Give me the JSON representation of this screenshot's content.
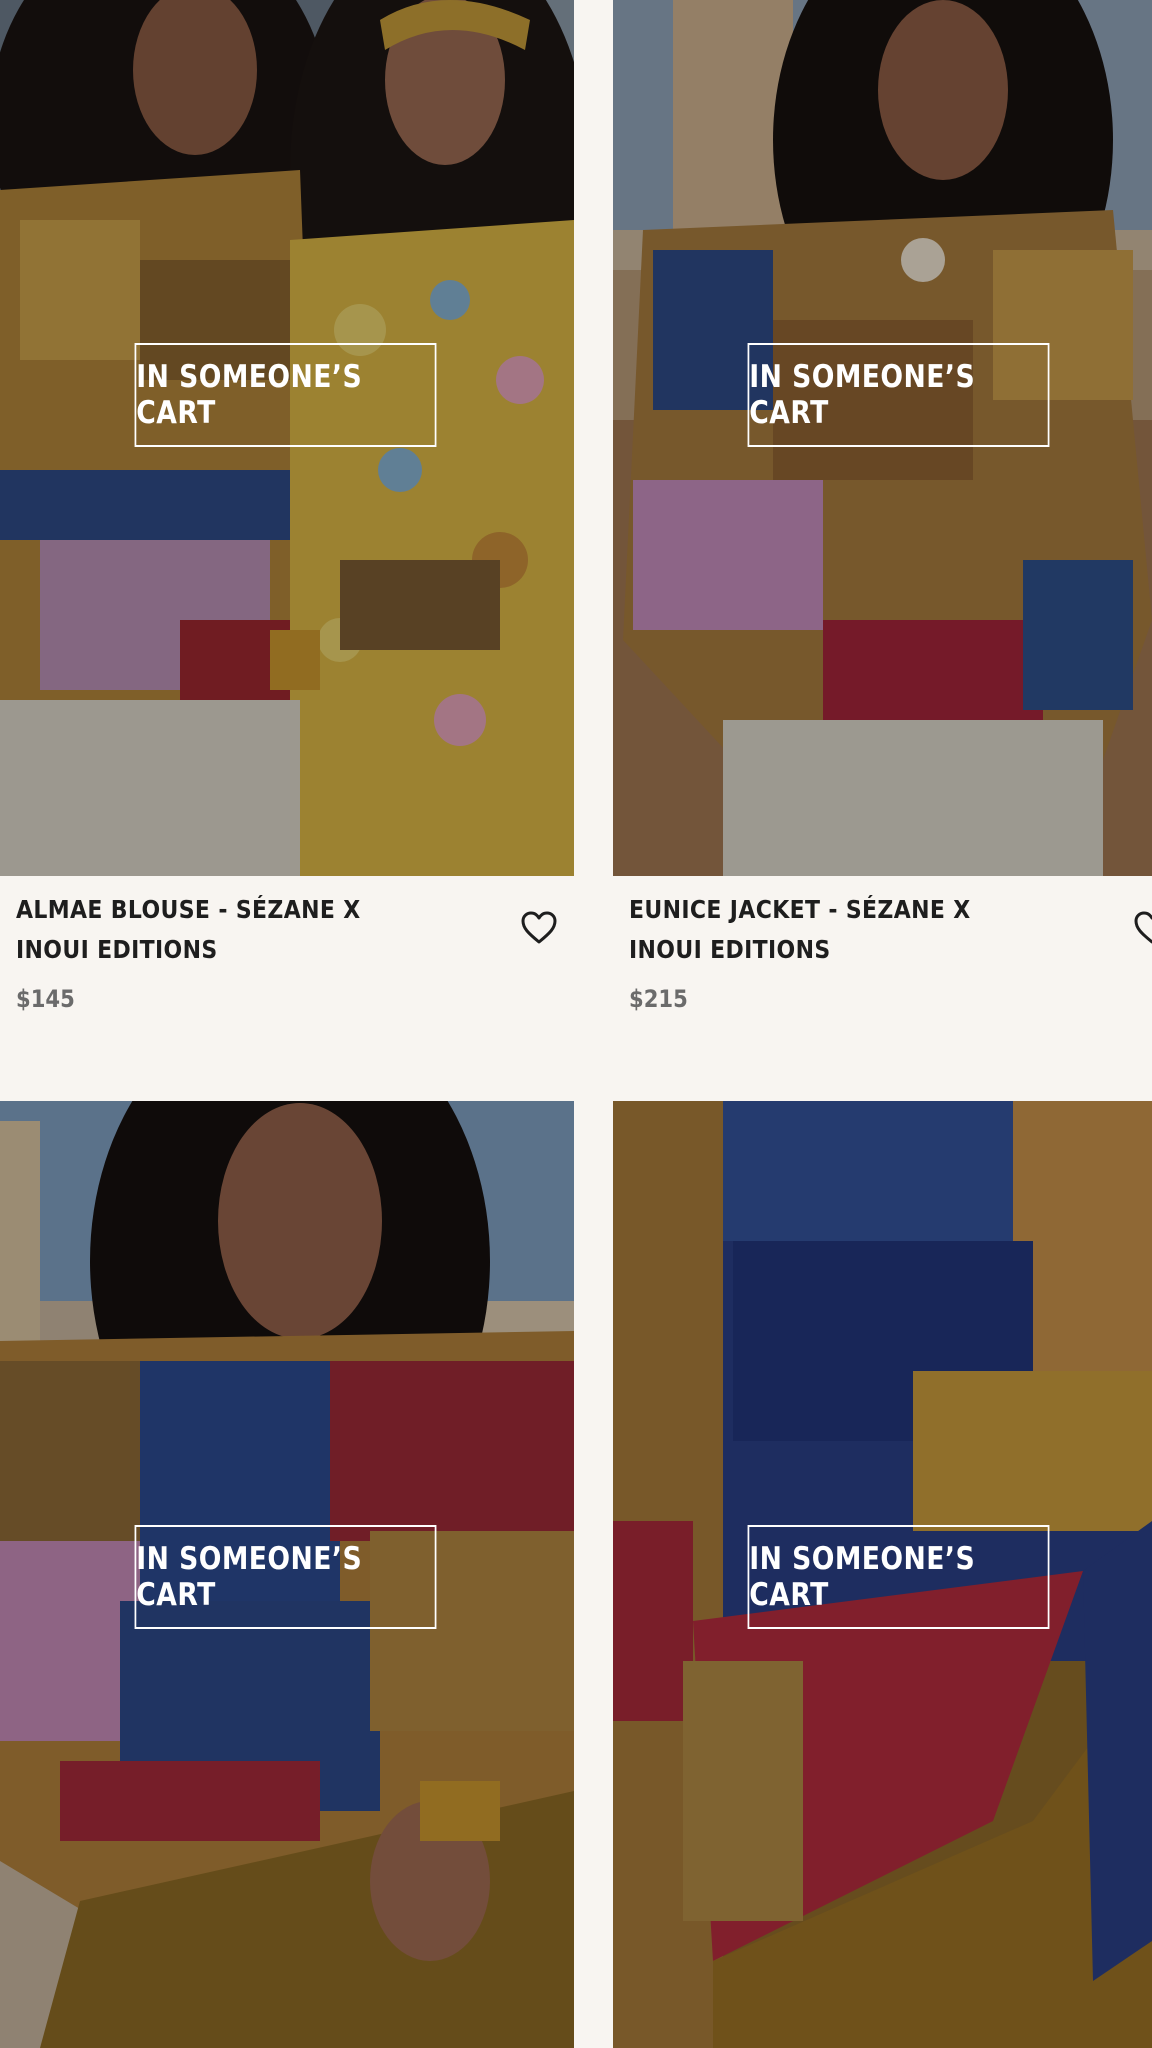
{
  "products": [
    {
      "title": "ALMAE BLOUSE - SÉZANE X INOUI EDITIONS",
      "price": "$145",
      "badge": "IN SOMEONE’S CART",
      "wishlist_icon": "heart-outline-icon"
    },
    {
      "title": "EUNICE JACKET - SÉZANE X INOUI EDITIONS",
      "price": "$215",
      "badge": "IN SOMEONE’S CART",
      "wishlist_icon": "heart-outline-icon"
    },
    {
      "badge": "IN SOMEONE’S CART"
    },
    {
      "badge": "IN SOMEONE’S CART"
    }
  ],
  "colors": {
    "background": "#f8f5f1",
    "text": "#1e1e1e",
    "price": "#6b6b6b",
    "badge_border": "#ffffff"
  }
}
